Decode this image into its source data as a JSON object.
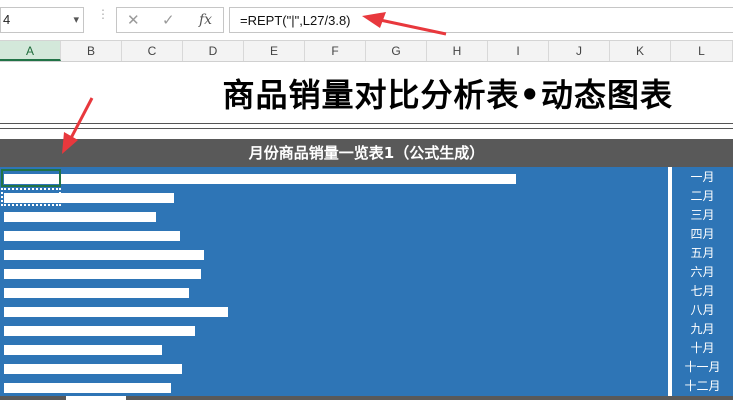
{
  "formula_bar": {
    "name_box": "4",
    "cancel_glyph": "✕",
    "enter_glyph": "✓",
    "fx_label": "fx",
    "formula": "=REPT(\"|\",L27/3.8)"
  },
  "columns": [
    "A",
    "B",
    "C",
    "D",
    "E",
    "F",
    "G",
    "H",
    "I",
    "J",
    "K",
    "L"
  ],
  "title": "商品销量对比分析表•动态图表",
  "table_header": "月份商品销量一览表1（公式生成）",
  "chart_data": {
    "type": "bar",
    "categories": [
      "一月",
      "二月",
      "三月",
      "四月",
      "五月",
      "六月",
      "七月",
      "八月",
      "九月",
      "十月",
      "十一月",
      "十二月"
    ],
    "values": [
      512,
      170,
      152,
      176,
      200,
      197,
      185,
      224,
      191,
      158,
      178,
      167
    ],
    "value_unit": "bar length (relative)"
  },
  "colors": {
    "chart_fill": "#2e75b6",
    "header_fill": "#595959",
    "bar": "#ffffff",
    "annotation": "#e8383d"
  }
}
